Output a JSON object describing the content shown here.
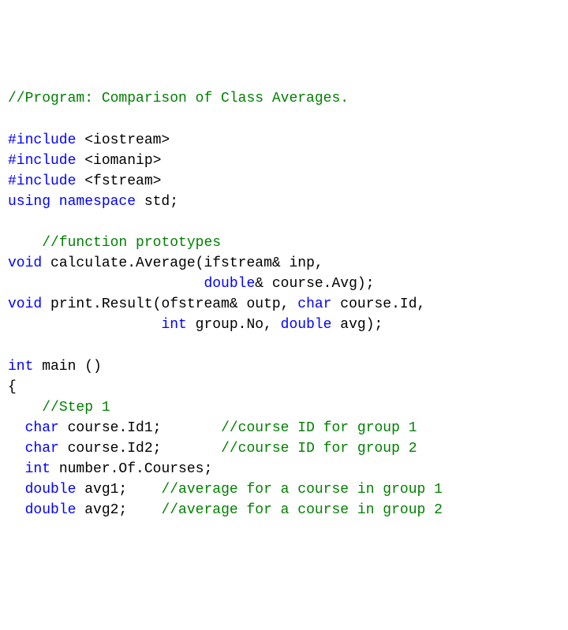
{
  "code": {
    "tokens": [
      [
        [
          "cm",
          "//Program: Comparison of Class Averages."
        ]
      ],
      [
        [
          "pl",
          ""
        ]
      ],
      [
        [
          "kw",
          "#include "
        ],
        [
          "pl",
          "<iostream>"
        ]
      ],
      [
        [
          "kw",
          "#include "
        ],
        [
          "pl",
          "<iomanip>"
        ]
      ],
      [
        [
          "kw",
          "#include "
        ],
        [
          "pl",
          "<fstream>"
        ]
      ],
      [
        [
          "kw",
          "using namespace"
        ],
        [
          "pl",
          " std;"
        ]
      ],
      [
        [
          "pl",
          ""
        ]
      ],
      [
        [
          "pl",
          "    "
        ],
        [
          "cm",
          "//function prototypes"
        ]
      ],
      [
        [
          "kw",
          "void"
        ],
        [
          "pl",
          " calculate.Average(ifstream& inp,"
        ]
      ],
      [
        [
          "pl",
          "                       "
        ],
        [
          "kw",
          "double"
        ],
        [
          "pl",
          "& course.Avg);"
        ]
      ],
      [
        [
          "kw",
          "void"
        ],
        [
          "pl",
          " print.Result(ofstream& outp, "
        ],
        [
          "kw",
          "char"
        ],
        [
          "pl",
          " course.Id,"
        ]
      ],
      [
        [
          "pl",
          "                  "
        ],
        [
          "kw",
          "int"
        ],
        [
          "pl",
          " group.No, "
        ],
        [
          "kw",
          "double"
        ],
        [
          "pl",
          " avg);"
        ]
      ],
      [
        [
          "pl",
          ""
        ]
      ],
      [
        [
          "kw",
          "int"
        ],
        [
          "pl",
          " main ()"
        ]
      ],
      [
        [
          "pl",
          "{"
        ]
      ],
      [
        [
          "pl",
          "    "
        ],
        [
          "cm",
          "//Step 1"
        ]
      ],
      [
        [
          "pl",
          "  "
        ],
        [
          "kw",
          "char"
        ],
        [
          "pl",
          " course.Id1;       "
        ],
        [
          "cm",
          "//course ID for group 1"
        ]
      ],
      [
        [
          "pl",
          "  "
        ],
        [
          "kw",
          "char"
        ],
        [
          "pl",
          " course.Id2;       "
        ],
        [
          "cm",
          "//course ID for group 2"
        ]
      ],
      [
        [
          "pl",
          "  "
        ],
        [
          "kw",
          "int"
        ],
        [
          "pl",
          " number.Of.Courses;"
        ]
      ],
      [
        [
          "pl",
          "  "
        ],
        [
          "kw",
          "double"
        ],
        [
          "pl",
          " avg1;    "
        ],
        [
          "cm",
          "//average for a course in group 1"
        ]
      ],
      [
        [
          "pl",
          "  "
        ],
        [
          "kw",
          "double"
        ],
        [
          "pl",
          " avg2;    "
        ],
        [
          "cm",
          "//average for a course in group 2"
        ]
      ]
    ]
  },
  "chart_data": {
    "type": "table",
    "title": "C++ source code: Comparison of Class Averages",
    "lines": [
      "//Program: Comparison of Class Averages.",
      "",
      "#include <iostream>",
      "#include <iomanip>",
      "#include <fstream>",
      "using namespace std;",
      "",
      "    //function prototypes",
      "void calculate.Average(ifstream& inp,",
      "                       double& course.Avg);",
      "void print.Result(ofstream& outp, char course.Id,",
      "                  int group.No, double avg);",
      "",
      "int main ()",
      "{",
      "    //Step 1",
      "  char course.Id1;       //course ID for group 1",
      "  char course.Id2;       //course ID for group 2",
      "  int number.Of.Courses;",
      "  double avg1;    //average for a course in group 1",
      "  double avg2;    //average for a course in group 2"
    ]
  }
}
